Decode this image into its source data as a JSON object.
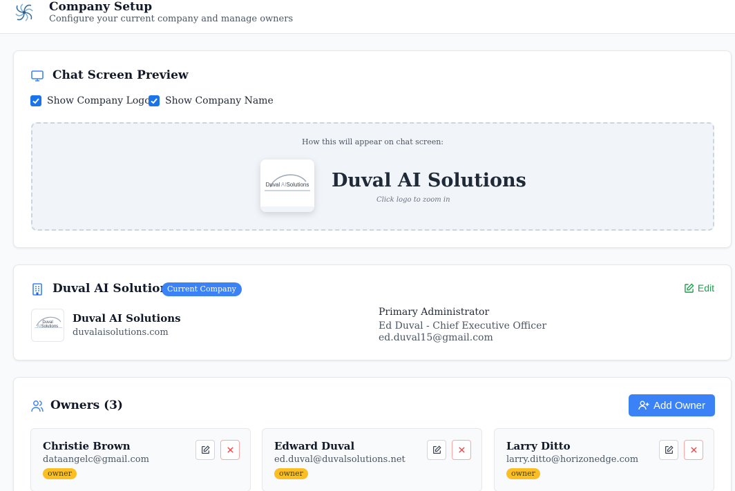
{
  "header": {
    "title": "Company Setup",
    "subtitle": "Configure your current company and manage owners"
  },
  "preview_section": {
    "title": "Chat Screen Preview",
    "show_logo_label": "Show Company Logo",
    "show_logo_checked": true,
    "show_name_label": "Show Company Name",
    "show_name_checked": true,
    "caption": "How this will appear on chat screen:",
    "company_name": "Duval AI Solutions",
    "zoom_hint": "Click logo to zoom in"
  },
  "logo_text": {
    "brand": "Duval ",
    "brand_accent": "AI",
    "brand_suffix": "Solutions"
  },
  "company_section": {
    "title": "Duval AI Solutions",
    "badge": "Current Company",
    "edit_label": "Edit",
    "company_name": "Duval AI Solutions",
    "domain": "duvalaisolutions.com",
    "admin_label": "Primary Administrator",
    "admin_name": "Ed Duval - Chief Executive Officer",
    "admin_email": "ed.duval15@gmail.com"
  },
  "owners_section": {
    "title": "Owners (3)",
    "add_button_label": "Add Owner",
    "owners": [
      {
        "name": "Christie Brown",
        "email": "dataangelc@gmail.com",
        "role": "owner"
      },
      {
        "name": "Edward Duval",
        "email": "ed.duval@duvalsolutions.net",
        "role": "owner"
      },
      {
        "name": "Larry Ditto",
        "email": "larry.ditto@horizonedge.com",
        "role": "owner"
      }
    ]
  },
  "colors": {
    "accent": "#3b82f6",
    "checkbox": "#1a73e8",
    "edit_green": "#16a34a",
    "delete_red": "#ef4444",
    "owner_badge": "#fbbf24"
  },
  "icons": [
    "pinwheel-logo-icon",
    "monitor-icon",
    "checkmark-icon",
    "building-icon",
    "edit-square-icon",
    "users-icon",
    "user-plus-icon",
    "pencil-icon",
    "close-icon"
  ]
}
